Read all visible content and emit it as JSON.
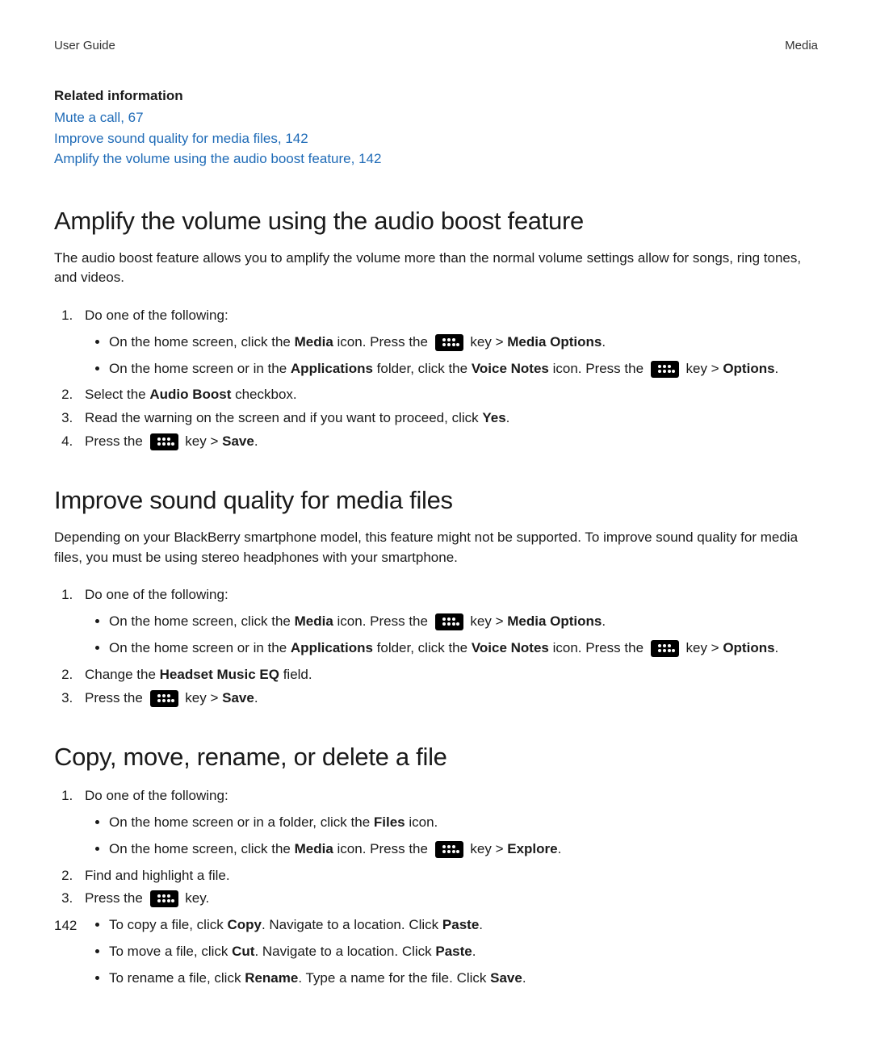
{
  "header": {
    "left": "User Guide",
    "right": "Media"
  },
  "related": {
    "heading": "Related information",
    "items": [
      {
        "text": "Mute a call,",
        "page": "67"
      },
      {
        "text": "Improve sound quality for media files,",
        "page": "142"
      },
      {
        "text": "Amplify the volume using the audio boost feature,",
        "page": "142"
      }
    ]
  },
  "section1": {
    "title": "Amplify the volume using the audio boost feature",
    "intro": "The audio boost feature allows you to amplify the volume more than the normal volume settings allow for songs, ring tones, and videos.",
    "step1_lead": "Do one of the following:",
    "bullet1a_pre": "On the home screen, click the ",
    "bullet1a_b1": "Media",
    "bullet1a_mid": " icon. Press the ",
    "bullet1a_mid2": " key > ",
    "bullet1a_b2": "Media Options",
    "bullet1a_end": ".",
    "bullet1b_pre": "On the home screen or in the ",
    "bullet1b_b1": "Applications",
    "bullet1b_mid1": " folder, click the ",
    "bullet1b_b2": "Voice Notes",
    "bullet1b_mid2": " icon. Press the ",
    "bullet1b_mid3": " key > ",
    "bullet1b_b3": "Options",
    "bullet1b_end": ".",
    "step2_pre": "Select the ",
    "step2_b": "Audio Boost",
    "step2_end": " checkbox.",
    "step3_pre": "Read the warning on the screen and if you want to proceed, click ",
    "step3_b": "Yes",
    "step3_end": ".",
    "step4_pre": "Press the ",
    "step4_mid": " key > ",
    "step4_b": "Save",
    "step4_end": "."
  },
  "section2": {
    "title": "Improve sound quality for media files",
    "intro": "Depending on your BlackBerry smartphone model, this feature might not be supported. To improve sound quality for media files, you must be using stereo headphones with your smartphone.",
    "step1_lead": "Do one of the following:",
    "bullet2a_pre": "On the home screen, click the ",
    "bullet2a_b1": "Media",
    "bullet2a_mid": " icon. Press the ",
    "bullet2a_mid2": " key > ",
    "bullet2a_b2": "Media Options",
    "bullet2a_end": ".",
    "bullet2b_pre": "On the home screen or in the ",
    "bullet2b_b1": "Applications",
    "bullet2b_mid1": " folder, click the ",
    "bullet2b_b2": "Voice Notes",
    "bullet2b_mid2": " icon. Press the ",
    "bullet2b_mid3": " key > ",
    "bullet2b_b3": "Options",
    "bullet2b_end": ".",
    "step2_pre": "Change the ",
    "step2_b": "Headset Music EQ",
    "step2_end": " field.",
    "step3_pre": "Press the ",
    "step3_mid": " key > ",
    "step3_b": "Save",
    "step3_end": "."
  },
  "section3": {
    "title": "Copy, move, rename, or delete a file",
    "step1_lead": "Do one of the following:",
    "bullet3a_pre": "On the home screen or in a folder, click the ",
    "bullet3a_b1": "Files",
    "bullet3a_end": " icon.",
    "bullet3b_pre": "On the home screen, click the ",
    "bullet3b_b1": "Media",
    "bullet3b_mid": " icon. Press the ",
    "bullet3b_mid2": " key > ",
    "bullet3b_b2": "Explore",
    "bullet3b_end": ".",
    "step2": "Find and highlight a file.",
    "step3_pre": "Press the ",
    "step3_end": " key.",
    "bullet3c_pre": "To copy a file, click ",
    "bullet3c_b1": "Copy",
    "bullet3c_mid": ". Navigate to a location. Click ",
    "bullet3c_b2": "Paste",
    "bullet3c_end": ".",
    "bullet3d_pre": "To move a file, click ",
    "bullet3d_b1": "Cut",
    "bullet3d_mid": ". Navigate to a location. Click ",
    "bullet3d_b2": "Paste",
    "bullet3d_end": ".",
    "bullet3e_pre": "To rename a file, click ",
    "bullet3e_b1": "Rename",
    "bullet3e_mid": ". Type a name for the file. Click ",
    "bullet3e_b2": "Save",
    "bullet3e_end": "."
  },
  "page_number": "142"
}
